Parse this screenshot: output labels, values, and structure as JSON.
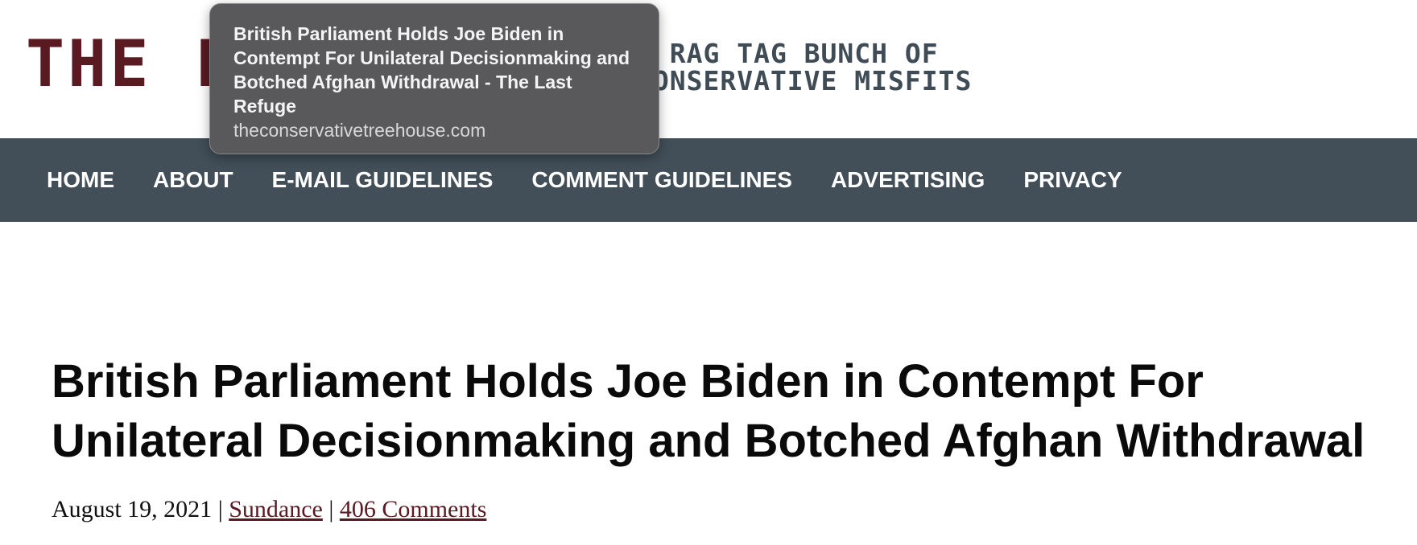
{
  "header": {
    "logo_text": "THE LAST REFUGE",
    "tagline_line1": "A RAG TAG BUNCH OF",
    "tagline_line2": "CONSERVATIVE MISFITS"
  },
  "nav": {
    "items": [
      {
        "label": "HOME"
      },
      {
        "label": "ABOUT"
      },
      {
        "label": "E-MAIL GUIDELINES"
      },
      {
        "label": "COMMENT GUIDELINES"
      },
      {
        "label": "ADVERTISING"
      },
      {
        "label": "PRIVACY"
      }
    ]
  },
  "tooltip": {
    "title": "British Parliament Holds Joe Biden in Contempt For Unilateral Decisionmaking and Botched Afghan Withdrawal - The Last Refuge",
    "url": "theconservativetreehouse.com"
  },
  "article": {
    "title": "British Parliament Holds Joe Biden in Contempt For Unilateral Decisionmaking and Botched Afghan Withdrawal",
    "date": "August 19, 2021",
    "separator": "|",
    "author": "Sundance",
    "comments": "406 Comments"
  },
  "colors": {
    "logo": "#5a1a22",
    "tagline": "#3f4b55",
    "nav_bg": "#424e58",
    "link": "#5a1a22",
    "tooltip_bg": "#59585b"
  }
}
